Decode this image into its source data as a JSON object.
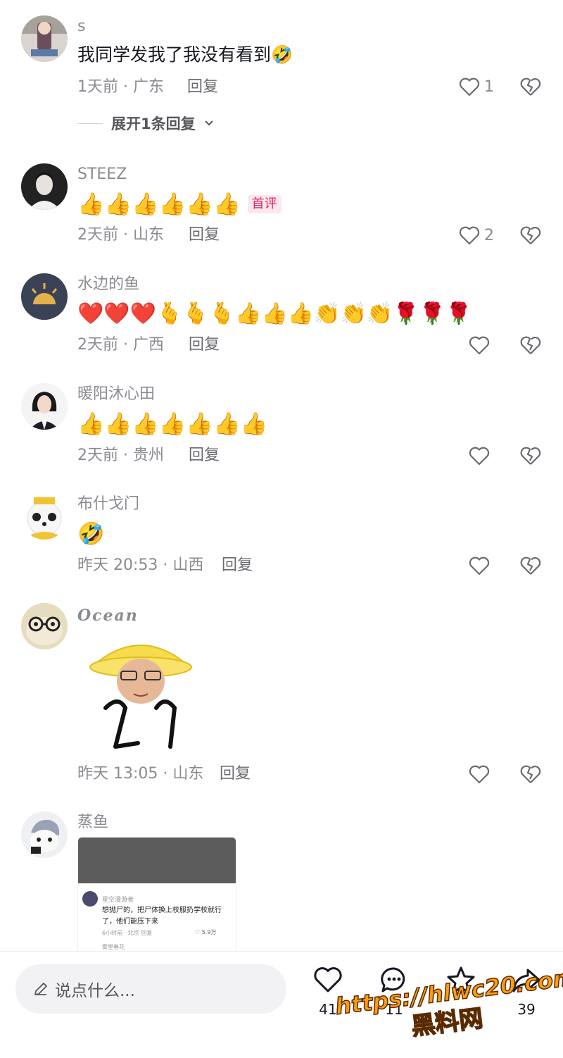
{
  "comments": [
    {
      "username": "s",
      "text": "我同学发我了我没有看到🤣",
      "time": "1天前 · 广东",
      "reply": "回复",
      "likes": "1",
      "expand": "展开1条回复"
    },
    {
      "username": "STEEZ",
      "emojis": "👍👍👍👍👍👍",
      "badge": "首评",
      "time": "2天前 · 山东",
      "reply": "回复",
      "likes": "2"
    },
    {
      "username": "水边的鱼",
      "emojis": "❤️❤️❤️🫰🫰🫰👍👍👍👏👏👏🌹🌹🌹",
      "time": "2天前 · 广西",
      "reply": "回复"
    },
    {
      "username": "暖阳沐心田",
      "emojis": "👍👍👍👍👍👍👍",
      "time": "2天前 · 贵州",
      "reply": "回复"
    },
    {
      "username": "布什戈门",
      "emojis": "🤣",
      "time": "昨天 20:53 · 山西",
      "reply": "回复"
    },
    {
      "username": "Ocean",
      "time": "昨天 13:05 · 山东",
      "reply": "回复"
    },
    {
      "username": "蒸鱼",
      "screenshot": {
        "name": "星空漫游者",
        "text": "想抛尸的，把尸体换上校服扔学校就行了，他们能压下来",
        "meta": "6小时前 · 北京",
        "likes": "5.9万",
        "reply": "回复",
        "sub_name": "雾里春花"
      }
    }
  ],
  "bottom_bar": {
    "input_placeholder": "说点什么...",
    "like_count": "41",
    "comment_count": "11",
    "share_count": "39"
  },
  "watermark": {
    "line1": "https://hlwc20.com",
    "line2": "黑料网"
  },
  "colors": {
    "accent": "#e0245e",
    "meta": "#8a8b91",
    "watermark": "#ff9d10"
  }
}
